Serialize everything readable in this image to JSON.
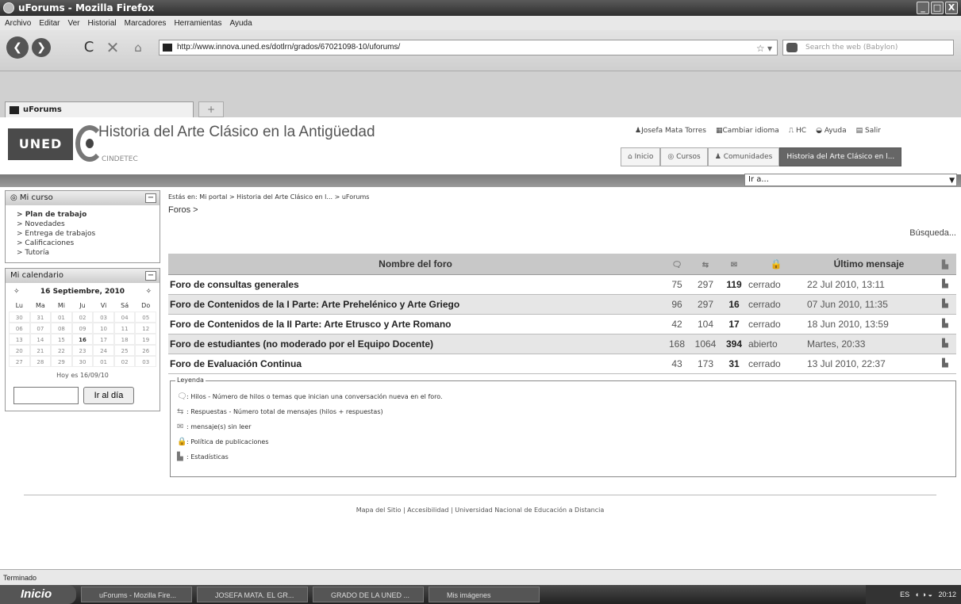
{
  "window": {
    "title": "uForums - Mozilla Firefox",
    "controls": [
      "_",
      "□",
      "X"
    ]
  },
  "menu": [
    "Archivo",
    "Editar",
    "Ver",
    "Historial",
    "Marcadores",
    "Herramientas",
    "Ayuda"
  ],
  "nav": {
    "url": "http://www.innova.uned.es/dotlrn/grados/67021098-10/uforums/",
    "search_placeholder": "Search the web (Babylon)"
  },
  "tabs": [
    {
      "label": "uForums"
    }
  ],
  "header": {
    "logo": "UNED",
    "title": "Historia del Arte Clásico en la Antigüedad",
    "subtitle": "CINDETEC",
    "user_links": [
      "Josefa Mata Torres",
      "Cambiar idioma",
      "HC",
      "Ayuda",
      "Salir"
    ],
    "nav_tabs": [
      "Inicio",
      "Cursos",
      "Comunidades",
      "Historia del Arte Clásico en l..."
    ],
    "goto": "Ir a..."
  },
  "sidebar": {
    "mi_curso": "Mi curso",
    "items": [
      "Plan de trabajo",
      "Novedades",
      "Entrega de trabajos",
      "Calificaciones",
      "Tutoría"
    ],
    "calendar_title": "Mi calendario",
    "month": "16 Septiembre, 2010",
    "days": [
      "Lu",
      "Ma",
      "Mi",
      "Ju",
      "Vi",
      "Sá",
      "Do"
    ],
    "dates": [
      "30",
      "31",
      "01",
      "02",
      "03",
      "04",
      "05",
      "06",
      "07",
      "08",
      "09",
      "10",
      "11",
      "12",
      "13",
      "14",
      "15",
      "16",
      "17",
      "18",
      "19",
      "20",
      "21",
      "22",
      "23",
      "24",
      "25",
      "26",
      "27",
      "28",
      "29",
      "30",
      "01",
      "02",
      "03"
    ],
    "hoy": "Hoy es 16/09/10",
    "btn": "Ir al día"
  },
  "main": {
    "breadcrumb": "Estás en: Mi portal > Historia del Arte Clásico en l... > uForums",
    "foros": "Foros >",
    "busqueda": "Búsqueda...",
    "columns": [
      "Nombre del foro",
      "Último mensaje"
    ],
    "rows": [
      {
        "name": "Foro de consultas generales",
        "hilos": "75",
        "resp": "297",
        "unread": "119",
        "policy": "cerrado",
        "last": "22 Jul 2010, 13:11"
      },
      {
        "name": "Foro de Contenidos de la I Parte: Arte Prehelénico y Arte Griego",
        "hilos": "96",
        "resp": "297",
        "unread": "16",
        "policy": "cerrado",
        "last": "07 Jun 2010, 11:35"
      },
      {
        "name": "Foro de Contenidos de la II Parte: Arte Etrusco y Arte Romano",
        "hilos": "42",
        "resp": "104",
        "unread": "17",
        "policy": "cerrado",
        "last": "18 Jun 2010, 13:59"
      },
      {
        "name": "Foro de estudiantes (no moderado por el Equipo Docente)",
        "hilos": "168",
        "resp": "1064",
        "unread": "394",
        "policy": "abierto",
        "last": "Martes, 20:33"
      },
      {
        "name": "Foro de Evaluación Continua",
        "hilos": "43",
        "resp": "173",
        "unread": "31",
        "policy": "cerrado",
        "last": "13 Jul 2010, 22:37"
      }
    ],
    "legend_title": "Leyenda",
    "legend": [
      ": Hilos - Número de hilos o temas que inician una conversación nueva en el foro.",
      ": Respuestas - Número total de mensajes (hilos + respuestas)",
      ": mensaje(s) sin leer",
      ": Política de publicaciones",
      ": Estadísticas"
    ]
  },
  "footer": "Mapa del Sitio | Accesibilidad | Universidad Nacional de Educación a Distancia",
  "status": "Terminado",
  "taskbar": {
    "start": "Inicio",
    "items": [
      "uForums - Mozilla Fire...",
      "JOSEFA MATA. EL GR...",
      "GRADO DE LA UNED ...",
      "Mis imágenes"
    ],
    "tray": "ES",
    "clock": "20:12"
  }
}
